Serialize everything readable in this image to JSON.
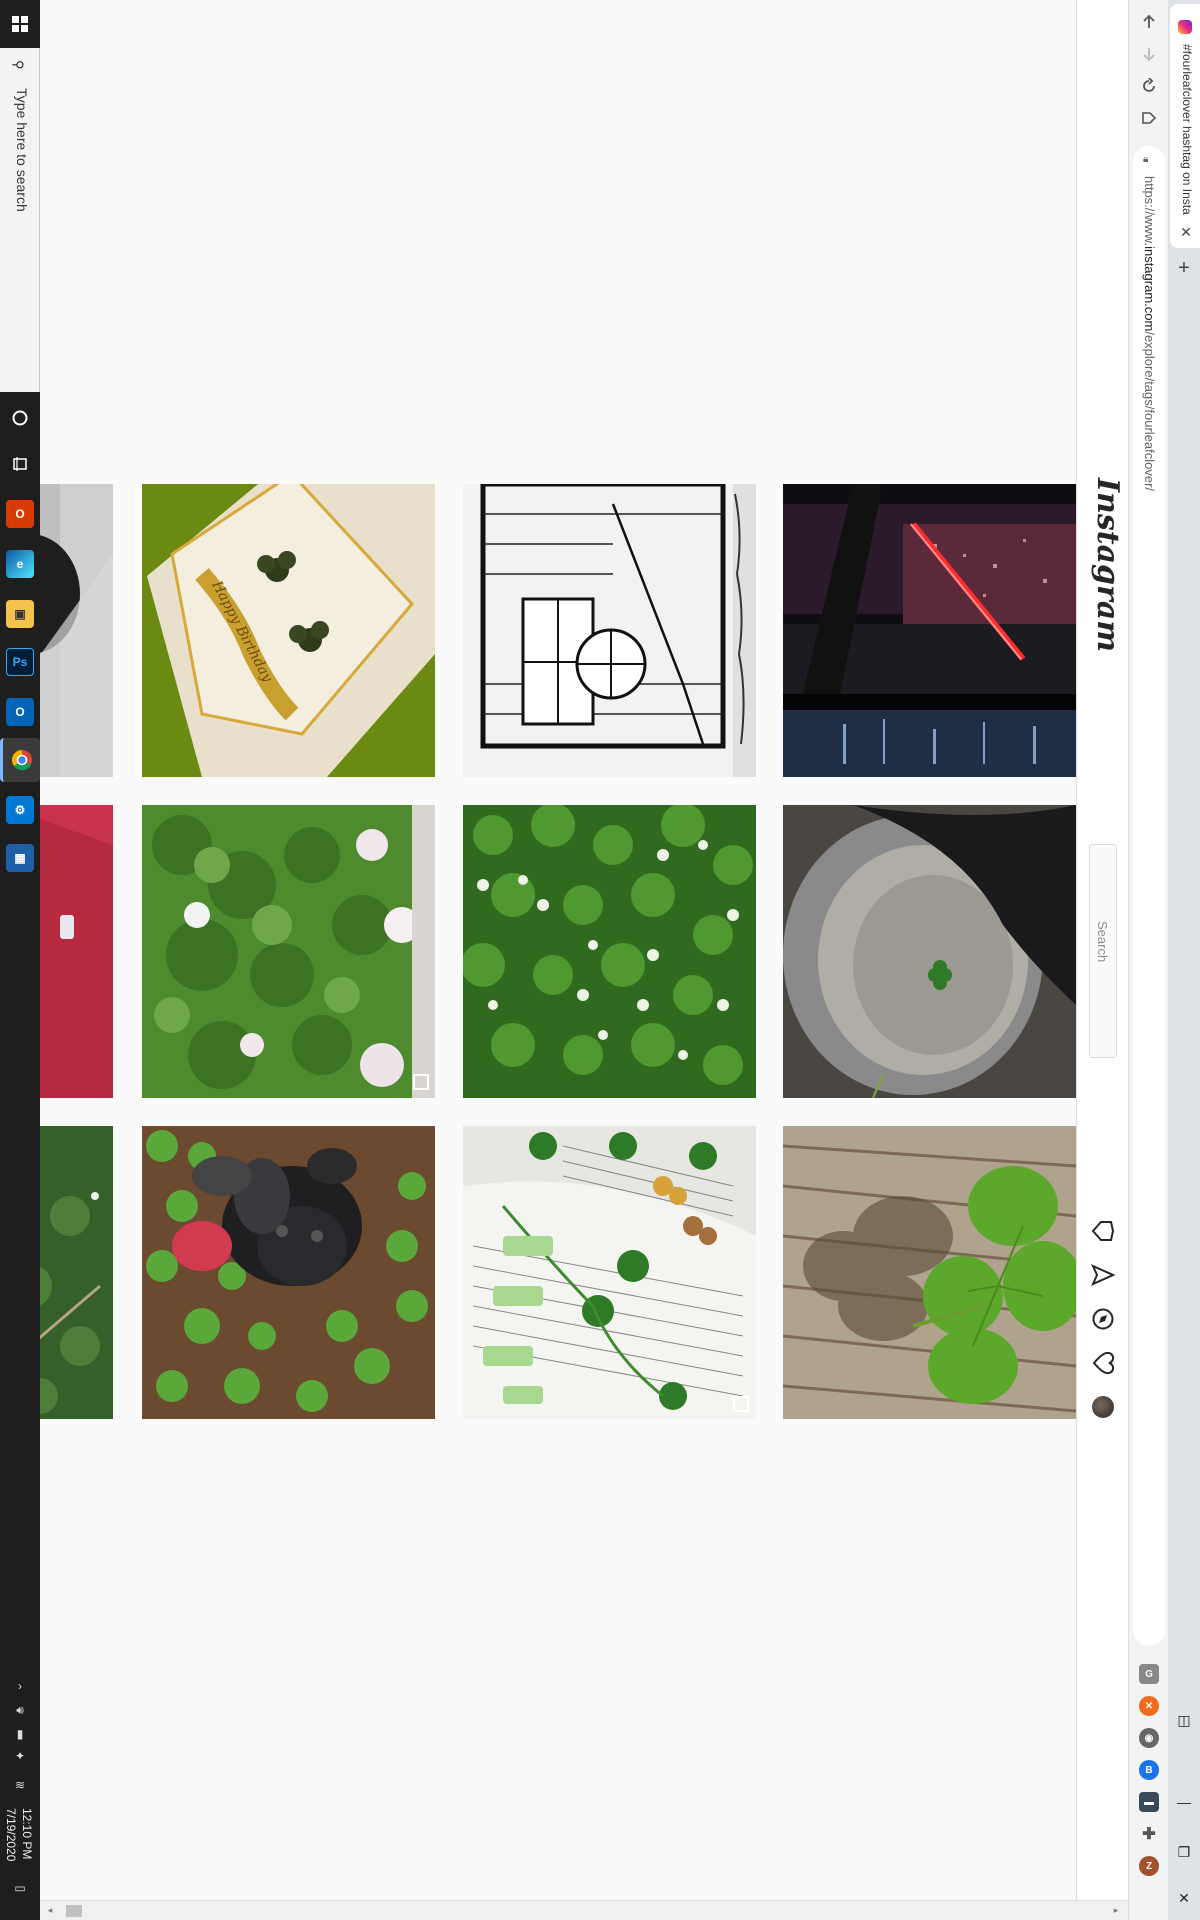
{
  "taskbar": {
    "search_placeholder": "Type here to search",
    "apps": [
      "cortana",
      "task-view",
      "office",
      "edge",
      "file-explorer",
      "photoshop",
      "outlook",
      "chrome",
      "settings",
      "store"
    ],
    "time": "12:10 PM",
    "date": "7/19/2020"
  },
  "browser": {
    "tab_title": "#fourleafclover hashtag on Insta",
    "url_prefix": "https://www.",
    "url_domain": "instagram.com",
    "url_path": "/explore/tags/fourleafclover/",
    "nav": {
      "back": "back-arrow",
      "forward": "forward-arrow",
      "reload": "reload",
      "home": "home"
    }
  },
  "instagram": {
    "logo": "Instagram",
    "search_placeholder": "Search",
    "nav_icons": [
      "home-icon",
      "direct-icon",
      "explore-icon",
      "activity-heart-icon",
      "profile-avatar"
    ]
  },
  "posts": [
    {
      "id": "r1c0",
      "subject": "partial dark object",
      "multi": false
    },
    {
      "id": "r1c1",
      "subject": "happy birthday card with clovers",
      "caption_text": "Happy Birthday",
      "multi": false
    },
    {
      "id": "r1c2",
      "subject": "pen sketch of house window",
      "multi": false
    },
    {
      "id": "r1c3",
      "subject": "red neon light city night",
      "multi": false
    },
    {
      "id": "r2c0",
      "subject": "red fabric",
      "multi": false
    },
    {
      "id": "r2c1",
      "subject": "clover patch with flowers",
      "multi": true
    },
    {
      "id": "r2c2",
      "subject": "clover field with white flowers",
      "multi": false
    },
    {
      "id": "r2c3",
      "subject": "clover at bottom of bucket",
      "multi": false
    },
    {
      "id": "r3c0",
      "subject": "grass edge",
      "multi": false
    },
    {
      "id": "r3c1",
      "subject": "black spaniel dog in clover",
      "multi": false
    },
    {
      "id": "r3c2",
      "subject": "pressed clovers in book",
      "multi": true
    },
    {
      "id": "r3c3",
      "subject": "four leaf clover on wooden table",
      "multi": false
    }
  ],
  "colors": {
    "ig_text": "#262626",
    "ig_border": "#dbdbdb",
    "page_bg": "#fafafa",
    "taskbar_bg": "#1e1e1e",
    "chrome_bg": "#f1f3f4"
  }
}
